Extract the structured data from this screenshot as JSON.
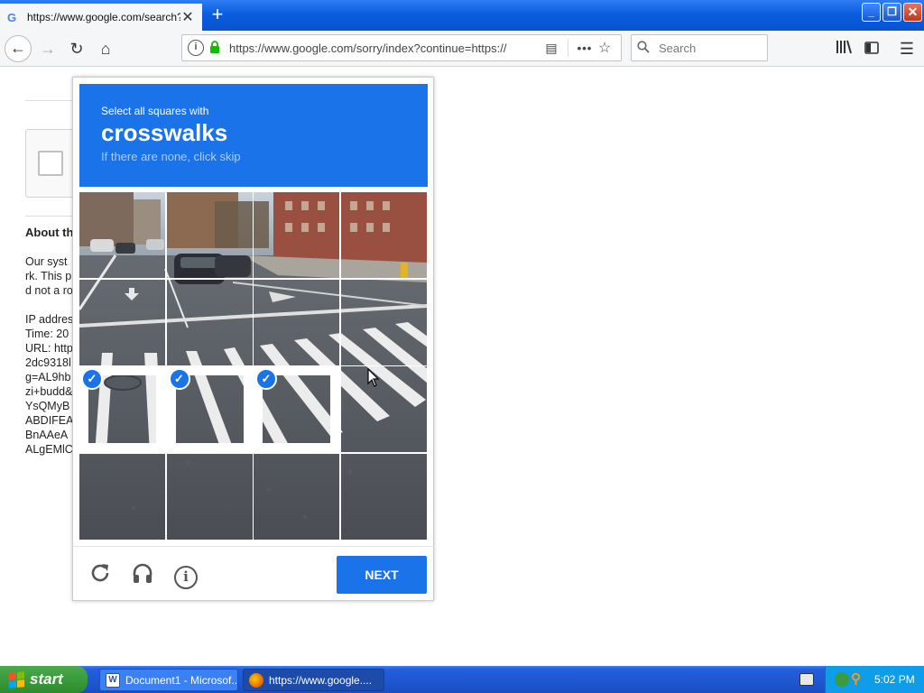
{
  "browser": {
    "tab_title": "https://www.google.com/search?q",
    "tab_favicon": "G",
    "tab_close": "✕",
    "new_tab": "+",
    "url": "https://www.google.com/sorry/index?continue=https://",
    "search_placeholder": "Search",
    "icons": {
      "back": "back-arrow-icon",
      "forward": "forward-arrow-icon",
      "reload": "reload-icon",
      "home": "home-icon",
      "info": "info-icon",
      "lock": "lock-icon",
      "reader": "reader-mode-icon",
      "more": "more-icon",
      "bookmark": "star-icon",
      "library": "library-icon",
      "sidebar": "sidebar-icon",
      "menu": "hamburger-icon"
    }
  },
  "page": {
    "about_heading": "About th",
    "about_lines": [
      "Our syst",
      "rk. This p",
      "d not a ro"
    ],
    "ip_lines": [
      "IP addres",
      "Time: 20",
      "URL: http",
      "2dc9318l",
      "g=AL9hb",
      "zi+budd&",
      "YsQMyB",
      "ABDIFEA",
      "BnAAeA",
      "ALgEMlC"
    ]
  },
  "challenge": {
    "instruction_pre": "Select all squares with",
    "instruction_keyword": "crosswalks",
    "instruction_sub": "If there are none, click skip",
    "grid_size": 4,
    "selected_tiles": [
      8,
      9,
      10
    ],
    "next_label": "NEXT",
    "footer_icons": [
      "reload-icon",
      "headphones-icon",
      "info-icon"
    ],
    "accent_color": "#1a73e8"
  },
  "taskbar": {
    "start_label": "start",
    "tasks": [
      {
        "label": "Document1 - Microsof...",
        "icon": "word-icon"
      },
      {
        "label": "https://www.google....",
        "icon": "firefox-icon"
      }
    ],
    "clock": "5:02 PM"
  }
}
